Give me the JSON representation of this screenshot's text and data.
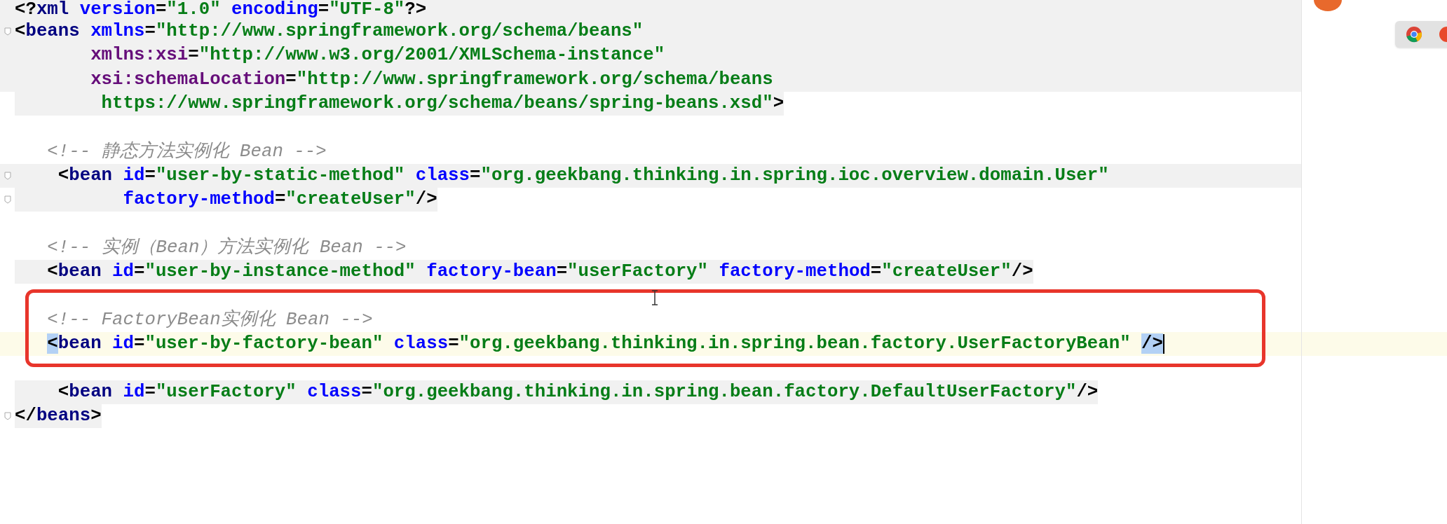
{
  "editor": {
    "lines": [
      {
        "kind": "block",
        "tokens": [
          {
            "kind": "punct",
            "text": "<?"
          },
          {
            "kind": "tag",
            "text": "xml"
          },
          {
            "kind": "attr",
            "text": " version"
          },
          {
            "kind": "punct",
            "text": "="
          },
          {
            "kind": "value",
            "text": "\"1.0\""
          },
          {
            "kind": "attr",
            "text": " encoding"
          },
          {
            "kind": "punct",
            "text": "="
          },
          {
            "kind": "value",
            "text": "\"UTF-8\""
          },
          {
            "kind": "punct",
            "text": "?>"
          }
        ]
      },
      {
        "kind": "block",
        "fold": true,
        "tokens": [
          {
            "kind": "punct",
            "text": "<"
          },
          {
            "kind": "tag",
            "text": "beans"
          },
          {
            "kind": "attr",
            "text": " xmlns"
          },
          {
            "kind": "punct",
            "text": "="
          },
          {
            "kind": "value",
            "text": "\"http://www.springframework.org/schema/beans\""
          }
        ]
      },
      {
        "kind": "block",
        "tokens": [
          {
            "kind": "ns",
            "text": "       xmlns:xsi"
          },
          {
            "kind": "punct",
            "text": "="
          },
          {
            "kind": "value",
            "text": "\"http://www.w3.org/2001/XMLSchema-instance\""
          }
        ]
      },
      {
        "kind": "block",
        "tokens": [
          {
            "kind": "ns",
            "text": "       xsi:schemaLocation"
          },
          {
            "kind": "punct",
            "text": "="
          },
          {
            "kind": "value",
            "text": "\"http://www.springframework.org/schema/beans"
          }
        ]
      },
      {
        "kind": "inline",
        "tokens": [
          {
            "kind": "value",
            "text": "        https://www.springframework.org/schema/beans/spring-beans.xsd\""
          },
          {
            "kind": "punct",
            "text": ">"
          }
        ]
      },
      {
        "kind": "plain"
      },
      {
        "kind": "plain",
        "tokens": [
          {
            "kind": "comment",
            "text": "   <!-- 静态方法实例化 Bean -->"
          }
        ]
      },
      {
        "kind": "block",
        "fold": true,
        "tokens": [
          {
            "kind": "punct",
            "text": "    <"
          },
          {
            "kind": "tag",
            "text": "bean"
          },
          {
            "kind": "attr",
            "text": " id"
          },
          {
            "kind": "punct",
            "text": "="
          },
          {
            "kind": "value",
            "text": "\"user-by-static-method\""
          },
          {
            "kind": "attr",
            "text": " class"
          },
          {
            "kind": "punct",
            "text": "="
          },
          {
            "kind": "value",
            "text": "\"org.geekbang.thinking.in.spring.ioc.overview.domain.User\""
          }
        ]
      },
      {
        "kind": "inline",
        "fold": true,
        "tokens": [
          {
            "kind": "attr",
            "text": "          factory-method"
          },
          {
            "kind": "punct",
            "text": "="
          },
          {
            "kind": "value",
            "text": "\"createUser\""
          },
          {
            "kind": "punct",
            "text": "/>"
          }
        ]
      },
      {
        "kind": "plain"
      },
      {
        "kind": "plain",
        "tokens": [
          {
            "kind": "comment",
            "text": "   <!-- 实例（Bean）方法实例化 Bean -->"
          }
        ]
      },
      {
        "kind": "inline",
        "tokens": [
          {
            "kind": "punct",
            "text": "   <"
          },
          {
            "kind": "tag",
            "text": "bean"
          },
          {
            "kind": "attr",
            "text": " id"
          },
          {
            "kind": "punct",
            "text": "="
          },
          {
            "kind": "value",
            "text": "\"user-by-instance-method\""
          },
          {
            "kind": "attr",
            "text": " factory-bean"
          },
          {
            "kind": "punct",
            "text": "="
          },
          {
            "kind": "value",
            "text": "\"userFactory\""
          },
          {
            "kind": "attr",
            "text": " factory-method"
          },
          {
            "kind": "punct",
            "text": "="
          },
          {
            "kind": "value",
            "text": "\"createUser\""
          },
          {
            "kind": "punct",
            "text": "/>"
          }
        ]
      },
      {
        "kind": "plain"
      },
      {
        "kind": "plain",
        "tokens": [
          {
            "kind": "comment",
            "text": "   <!-- FactoryBean实例化 Bean -->"
          }
        ]
      },
      {
        "kind": "current",
        "caret": true,
        "tokens": [
          {
            "kind": "match",
            "text": "   <"
          },
          {
            "kind": "tag",
            "text": "bean"
          },
          {
            "kind": "attr",
            "text": " id"
          },
          {
            "kind": "punct",
            "text": "="
          },
          {
            "kind": "value",
            "text": "\"user-by-factory-bean\""
          },
          {
            "kind": "attr",
            "text": " class"
          },
          {
            "kind": "punct",
            "text": "="
          },
          {
            "kind": "value",
            "text": "\"org.geekbang.thinking.in.spring.bean.factory.UserFactoryBean\""
          },
          {
            "kind": "match",
            "text": " />"
          }
        ]
      },
      {
        "kind": "plain"
      },
      {
        "kind": "inline",
        "tokens": [
          {
            "kind": "punct",
            "text": "    <"
          },
          {
            "kind": "tag",
            "text": "bean"
          },
          {
            "kind": "attr",
            "text": " id"
          },
          {
            "kind": "punct",
            "text": "="
          },
          {
            "kind": "value",
            "text": "\"userFactory\""
          },
          {
            "kind": "attr",
            "text": " class"
          },
          {
            "kind": "punct",
            "text": "="
          },
          {
            "kind": "value",
            "text": "\"org.geekbang.thinking.in.spring.bean.factory.DefaultUserFactory\""
          },
          {
            "kind": "punct",
            "text": "/>"
          }
        ]
      },
      {
        "kind": "inline",
        "fold": true,
        "tokens": [
          {
            "kind": "punct",
            "text": "</"
          },
          {
            "kind": "tag",
            "text": "beans"
          },
          {
            "kind": "punct",
            "text": ">"
          }
        ]
      }
    ]
  }
}
